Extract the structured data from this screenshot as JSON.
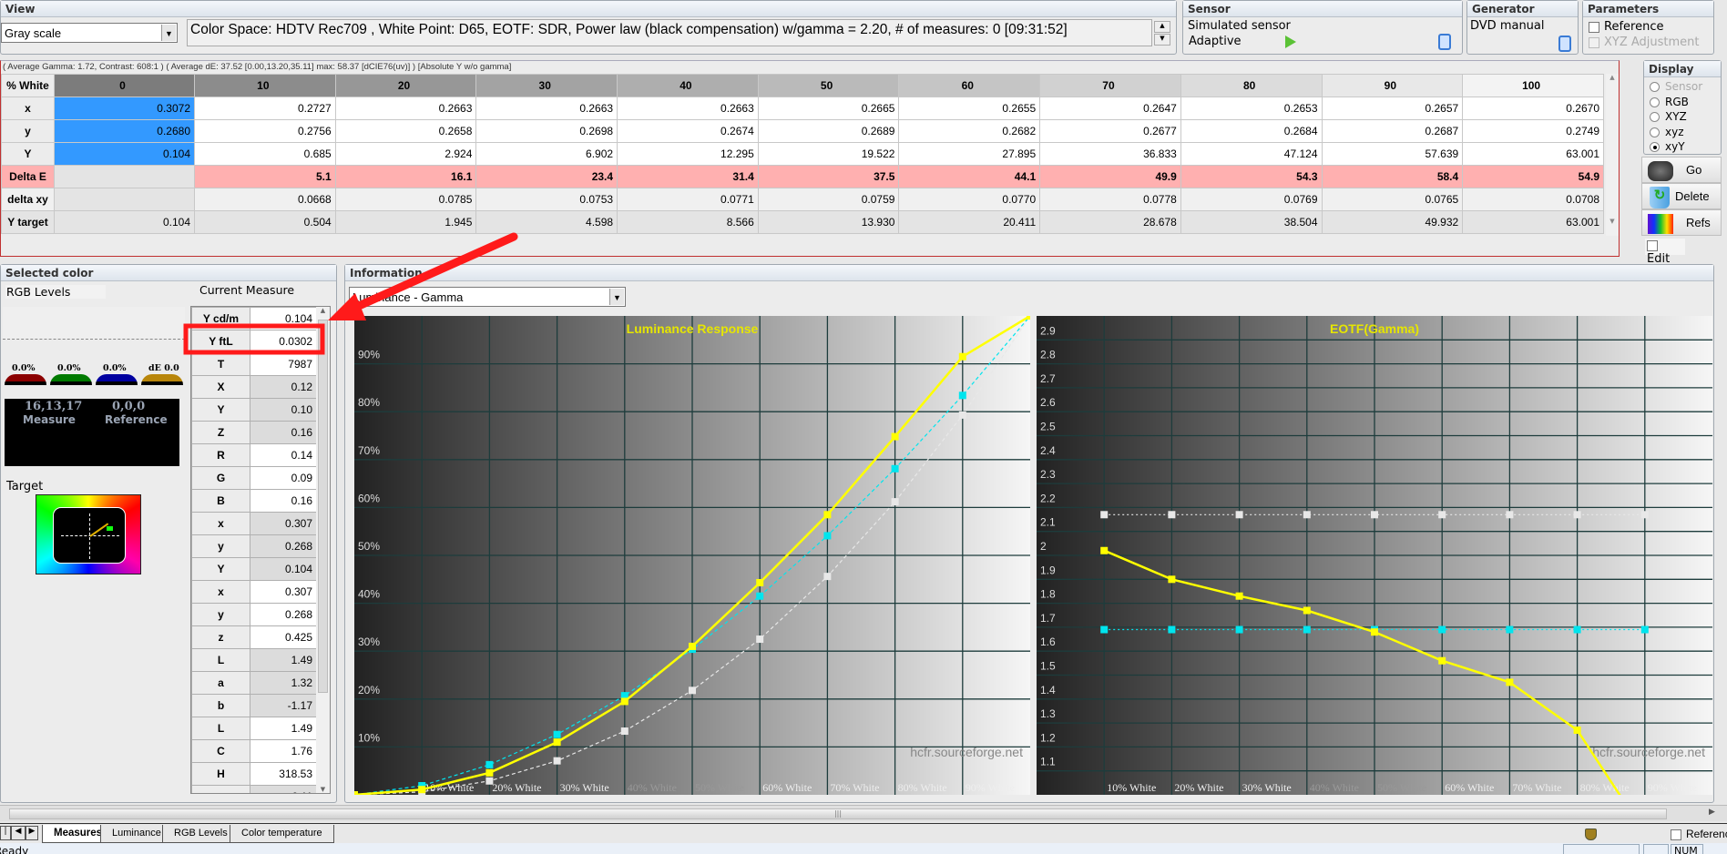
{
  "view": {
    "title": "View",
    "mode": "Gray scale",
    "info": "Color Space: HDTV Rec709 , White Point: D65, EOTF:  SDR, Power law (black compensation) w/gamma = 2.20, # of measures: 0 [09:31:52]"
  },
  "sensor": {
    "title": "Sensor",
    "name": "Simulated sensor",
    "mode": "Adaptive"
  },
  "generator": {
    "title": "Generator",
    "name": "DVD manual"
  },
  "parameters": {
    "title": "Parameters",
    "reference": "Reference",
    "reference_checked": false,
    "xyz_adjustment": "XYZ Adjustment",
    "xyz_adjustment_enabled": false
  },
  "summary": "( Average Gamma: 1.72, Contrast: 608:1 ) ( Average dE: 37.52 [0.00,13.20,35.11] max: 58.37 [dCIE76(uv)] ) [Absolute Y w/o gamma]",
  "measures": {
    "header_label": "% White",
    "columns": [
      "0",
      "10",
      "20",
      "30",
      "40",
      "50",
      "60",
      "70",
      "80",
      "90",
      "100"
    ],
    "rows": [
      {
        "label": "x",
        "values": [
          "0.3072",
          "0.2727",
          "0.2663",
          "0.2663",
          "0.2663",
          "0.2665",
          "0.2655",
          "0.2647",
          "0.2653",
          "0.2657",
          "0.2670"
        ]
      },
      {
        "label": "y",
        "values": [
          "0.2680",
          "0.2756",
          "0.2658",
          "0.2698",
          "0.2674",
          "0.2689",
          "0.2682",
          "0.2677",
          "0.2684",
          "0.2687",
          "0.2749"
        ]
      },
      {
        "label": "Y",
        "values": [
          "0.104",
          "0.685",
          "2.924",
          "6.902",
          "12.295",
          "19.522",
          "27.895",
          "36.833",
          "47.124",
          "57.639",
          "63.001"
        ]
      },
      {
        "label": "Delta E",
        "values": [
          "",
          "5.1",
          "16.1",
          "23.4",
          "31.4",
          "37.5",
          "44.1",
          "49.9",
          "54.3",
          "58.4",
          "54.9"
        ]
      },
      {
        "label": "delta xy",
        "values": [
          "",
          "0.0668",
          "0.0785",
          "0.0753",
          "0.0771",
          "0.0759",
          "0.0770",
          "0.0778",
          "0.0769",
          "0.0765",
          "0.0708"
        ]
      },
      {
        "label": "Y target",
        "values": [
          "0.104",
          "0.504",
          "1.945",
          "4.598",
          "8.566",
          "13.930",
          "20.411",
          "28.678",
          "38.504",
          "49.932",
          "63.001"
        ]
      }
    ],
    "selected_color": "#3399ff",
    "delta_e_color": "#ffb0b0"
  },
  "display": {
    "title": "Display",
    "options": [
      "Sensor",
      "RGB",
      "XYZ",
      "xyz",
      "xyY"
    ],
    "selected": "xyY"
  },
  "actions": {
    "go": "Go",
    "delete": "Delete",
    "refs": "Refs",
    "edit": "Edit"
  },
  "selected_color": {
    "title": "Selected color",
    "rgb_levels": "RGB Levels",
    "current_measure": "Current Measure",
    "gauges": [
      "0.0%",
      "0.0%",
      "0.0%",
      "dE 0.0"
    ],
    "measure_rgb": "16,13,17",
    "measure_label": "Measure",
    "reference_rgb": "0,0,0",
    "reference_label": "Reference",
    "target_label": "Target",
    "values": [
      {
        "label": "Y cd/m",
        "value": "0.104"
      },
      {
        "label": "Y ftL",
        "value": "0.0302"
      },
      {
        "label": "T",
        "value": "7987"
      },
      {
        "label": "X",
        "value": "0.12"
      },
      {
        "label": "Y",
        "value": "0.10"
      },
      {
        "label": "Z",
        "value": "0.16"
      },
      {
        "label": "R",
        "value": "0.14"
      },
      {
        "label": "G",
        "value": "0.09"
      },
      {
        "label": "B",
        "value": "0.16"
      },
      {
        "label": "x",
        "value": "0.307"
      },
      {
        "label": "y",
        "value": "0.268"
      },
      {
        "label": "Y",
        "value": "0.104"
      },
      {
        "label": "x",
        "value": "0.307"
      },
      {
        "label": "y",
        "value": "0.268"
      },
      {
        "label": "z",
        "value": "0.425"
      },
      {
        "label": "L",
        "value": "1.49"
      },
      {
        "label": "a",
        "value": "1.32"
      },
      {
        "label": "b",
        "value": "-1.17"
      },
      {
        "label": "L",
        "value": "1.49"
      },
      {
        "label": "C",
        "value": "1.76"
      },
      {
        "label": "H",
        "value": "318.53"
      },
      {
        "label": "",
        "value": "0.11"
      }
    ]
  },
  "information": {
    "title": "Information",
    "chart_select": "Luminance - Gamma",
    "watermark": "hcfr.sourceforge.net"
  },
  "chart_data": [
    {
      "type": "line",
      "title": "Luminance Response",
      "x": [
        0,
        10,
        20,
        30,
        40,
        50,
        60,
        70,
        80,
        90,
        100
      ],
      "xlim": [
        0,
        100
      ],
      "ylim": [
        0,
        100
      ],
      "x_tick_labels": [
        "10% White",
        "20% White",
        "30% White",
        "40% White",
        "50% White",
        "60% White",
        "70% White",
        "80% White",
        "90% White"
      ],
      "y_tick_labels": [
        "10%",
        "20%",
        "30%",
        "40%",
        "50%",
        "60%",
        "70%",
        "80%",
        "90%"
      ],
      "grid": true,
      "series": [
        {
          "color": "#ffff00",
          "style": "solid",
          "values": [
            0,
            1.1,
            4.6,
            11.0,
            19.5,
            31.0,
            44.3,
            58.5,
            74.8,
            91.5,
            100
          ]
        },
        {
          "color": "#00e5ee",
          "style": "dashed",
          "values": [
            0,
            1.9,
            6.3,
            12.6,
            20.7,
            30.4,
            41.5,
            54.1,
            68.1,
            83.4,
            100
          ]
        },
        {
          "color": "#e8e8e8",
          "style": "dashed",
          "values": [
            0,
            0.6,
            2.9,
            7.1,
            13.3,
            21.8,
            32.5,
            45.6,
            61.2,
            79.3,
            100
          ]
        }
      ]
    },
    {
      "type": "line",
      "title": "EOTF(Gamma)",
      "x": [
        10,
        20,
        30,
        40,
        50,
        60,
        70,
        80,
        90
      ],
      "xlim": [
        0,
        100
      ],
      "ylim": [
        1.0,
        3.0
      ],
      "x_tick_labels": [
        "10% White",
        "20% White",
        "30% White",
        "40% White",
        "50% White",
        "60% White",
        "70% White",
        "80% White",
        "90% White"
      ],
      "y_tick_labels": [
        "1.1",
        "1.2",
        "1.3",
        "1.4",
        "1.5",
        "1.6",
        "1.7",
        "1.8",
        "1.9",
        "2",
        "2.1",
        "2.2",
        "2.3",
        "2.4",
        "2.5",
        "2.6",
        "2.7",
        "2.8",
        "2.9"
      ],
      "grid": true,
      "series": [
        {
          "color": "#ffff00",
          "style": "solid",
          "values": [
            2.02,
            1.9,
            1.83,
            1.77,
            1.68,
            1.56,
            1.47,
            1.27,
            0.84
          ]
        },
        {
          "color": "#e8e8e8",
          "style": "dotted",
          "values": [
            2.17,
            2.17,
            2.17,
            2.17,
            2.17,
            2.17,
            2.17,
            2.17,
            2.17
          ]
        },
        {
          "color": "#00e5ee",
          "style": "dotted",
          "values": [
            1.69,
            1.69,
            1.69,
            1.69,
            1.69,
            1.69,
            1.69,
            1.69,
            1.69
          ]
        }
      ]
    }
  ],
  "tabs": [
    "Measures",
    "Luminance",
    "RGB Levels",
    "Color temperature"
  ],
  "active_tab": "Measures",
  "status": {
    "text": "Ready",
    "reference": "Reference",
    "num": "NUM"
  },
  "annotation_color": "#ff1a1a"
}
